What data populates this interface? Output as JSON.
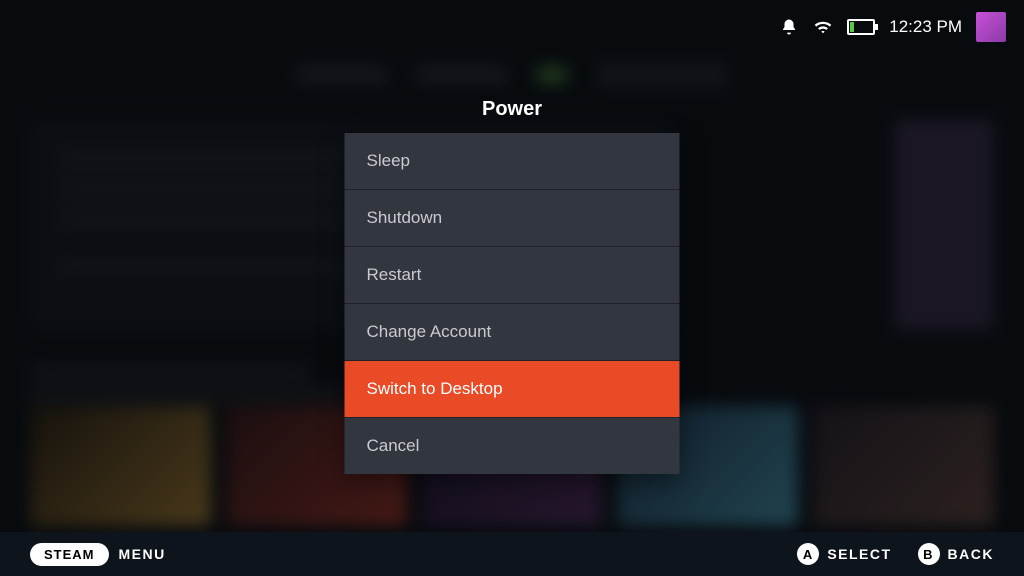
{
  "statusBar": {
    "clock": "12:23 PM"
  },
  "power": {
    "title": "Power",
    "items": [
      {
        "label": "Sleep",
        "selected": false
      },
      {
        "label": "Shutdown",
        "selected": false
      },
      {
        "label": "Restart",
        "selected": false
      },
      {
        "label": "Change Account",
        "selected": false
      },
      {
        "label": "Switch to Desktop",
        "selected": true
      },
      {
        "label": "Cancel",
        "selected": false
      }
    ]
  },
  "bottomBar": {
    "steamLabel": "STEAM",
    "menuLabel": "MENU",
    "hints": [
      {
        "button": "A",
        "label": "SELECT"
      },
      {
        "button": "B",
        "label": "BACK"
      }
    ]
  }
}
